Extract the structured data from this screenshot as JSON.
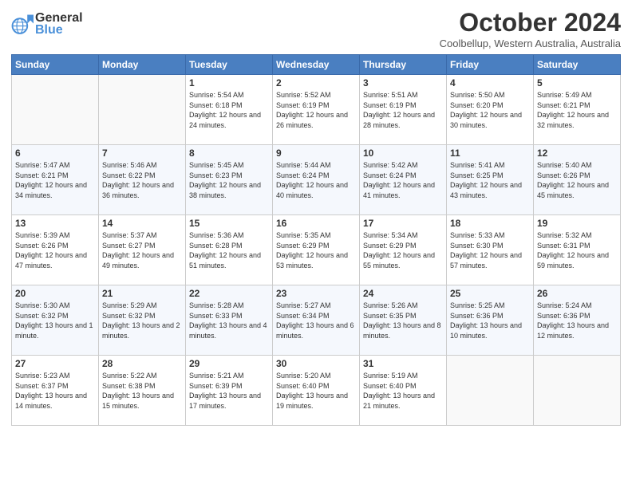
{
  "logo": {
    "line1": "General",
    "line2": "Blue"
  },
  "header": {
    "title": "October 2024",
    "subtitle": "Coolbellup, Western Australia, Australia"
  },
  "days_of_week": [
    "Sunday",
    "Monday",
    "Tuesday",
    "Wednesday",
    "Thursday",
    "Friday",
    "Saturday"
  ],
  "weeks": [
    [
      {
        "day": "",
        "info": ""
      },
      {
        "day": "",
        "info": ""
      },
      {
        "day": "1",
        "info": "Sunrise: 5:54 AM\nSunset: 6:18 PM\nDaylight: 12 hours and 24 minutes."
      },
      {
        "day": "2",
        "info": "Sunrise: 5:52 AM\nSunset: 6:19 PM\nDaylight: 12 hours and 26 minutes."
      },
      {
        "day": "3",
        "info": "Sunrise: 5:51 AM\nSunset: 6:19 PM\nDaylight: 12 hours and 28 minutes."
      },
      {
        "day": "4",
        "info": "Sunrise: 5:50 AM\nSunset: 6:20 PM\nDaylight: 12 hours and 30 minutes."
      },
      {
        "day": "5",
        "info": "Sunrise: 5:49 AM\nSunset: 6:21 PM\nDaylight: 12 hours and 32 minutes."
      }
    ],
    [
      {
        "day": "6",
        "info": "Sunrise: 5:47 AM\nSunset: 6:21 PM\nDaylight: 12 hours and 34 minutes."
      },
      {
        "day": "7",
        "info": "Sunrise: 5:46 AM\nSunset: 6:22 PM\nDaylight: 12 hours and 36 minutes."
      },
      {
        "day": "8",
        "info": "Sunrise: 5:45 AM\nSunset: 6:23 PM\nDaylight: 12 hours and 38 minutes."
      },
      {
        "day": "9",
        "info": "Sunrise: 5:44 AM\nSunset: 6:24 PM\nDaylight: 12 hours and 40 minutes."
      },
      {
        "day": "10",
        "info": "Sunrise: 5:42 AM\nSunset: 6:24 PM\nDaylight: 12 hours and 41 minutes."
      },
      {
        "day": "11",
        "info": "Sunrise: 5:41 AM\nSunset: 6:25 PM\nDaylight: 12 hours and 43 minutes."
      },
      {
        "day": "12",
        "info": "Sunrise: 5:40 AM\nSunset: 6:26 PM\nDaylight: 12 hours and 45 minutes."
      }
    ],
    [
      {
        "day": "13",
        "info": "Sunrise: 5:39 AM\nSunset: 6:26 PM\nDaylight: 12 hours and 47 minutes."
      },
      {
        "day": "14",
        "info": "Sunrise: 5:37 AM\nSunset: 6:27 PM\nDaylight: 12 hours and 49 minutes."
      },
      {
        "day": "15",
        "info": "Sunrise: 5:36 AM\nSunset: 6:28 PM\nDaylight: 12 hours and 51 minutes."
      },
      {
        "day": "16",
        "info": "Sunrise: 5:35 AM\nSunset: 6:29 PM\nDaylight: 12 hours and 53 minutes."
      },
      {
        "day": "17",
        "info": "Sunrise: 5:34 AM\nSunset: 6:29 PM\nDaylight: 12 hours and 55 minutes."
      },
      {
        "day": "18",
        "info": "Sunrise: 5:33 AM\nSunset: 6:30 PM\nDaylight: 12 hours and 57 minutes."
      },
      {
        "day": "19",
        "info": "Sunrise: 5:32 AM\nSunset: 6:31 PM\nDaylight: 12 hours and 59 minutes."
      }
    ],
    [
      {
        "day": "20",
        "info": "Sunrise: 5:30 AM\nSunset: 6:32 PM\nDaylight: 13 hours and 1 minute."
      },
      {
        "day": "21",
        "info": "Sunrise: 5:29 AM\nSunset: 6:32 PM\nDaylight: 13 hours and 2 minutes."
      },
      {
        "day": "22",
        "info": "Sunrise: 5:28 AM\nSunset: 6:33 PM\nDaylight: 13 hours and 4 minutes."
      },
      {
        "day": "23",
        "info": "Sunrise: 5:27 AM\nSunset: 6:34 PM\nDaylight: 13 hours and 6 minutes."
      },
      {
        "day": "24",
        "info": "Sunrise: 5:26 AM\nSunset: 6:35 PM\nDaylight: 13 hours and 8 minutes."
      },
      {
        "day": "25",
        "info": "Sunrise: 5:25 AM\nSunset: 6:36 PM\nDaylight: 13 hours and 10 minutes."
      },
      {
        "day": "26",
        "info": "Sunrise: 5:24 AM\nSunset: 6:36 PM\nDaylight: 13 hours and 12 minutes."
      }
    ],
    [
      {
        "day": "27",
        "info": "Sunrise: 5:23 AM\nSunset: 6:37 PM\nDaylight: 13 hours and 14 minutes."
      },
      {
        "day": "28",
        "info": "Sunrise: 5:22 AM\nSunset: 6:38 PM\nDaylight: 13 hours and 15 minutes."
      },
      {
        "day": "29",
        "info": "Sunrise: 5:21 AM\nSunset: 6:39 PM\nDaylight: 13 hours and 17 minutes."
      },
      {
        "day": "30",
        "info": "Sunrise: 5:20 AM\nSunset: 6:40 PM\nDaylight: 13 hours and 19 minutes."
      },
      {
        "day": "31",
        "info": "Sunrise: 5:19 AM\nSunset: 6:40 PM\nDaylight: 13 hours and 21 minutes."
      },
      {
        "day": "",
        "info": ""
      },
      {
        "day": "",
        "info": ""
      }
    ]
  ]
}
